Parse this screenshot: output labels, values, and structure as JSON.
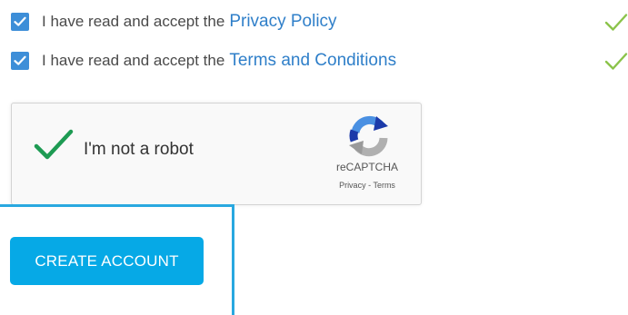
{
  "consents": [
    {
      "checked": true,
      "text": "I have read and accept the",
      "link": "Privacy Policy",
      "validated": true
    },
    {
      "checked": true,
      "text": "I have read and accept the",
      "link": "Terms and Conditions",
      "validated": true
    }
  ],
  "recaptcha": {
    "label": "I'm not a robot",
    "verified": true,
    "brand": "reCAPTCHA",
    "privacy_link": "Privacy",
    "separator": "-",
    "terms_link": "Terms"
  },
  "actions": {
    "create_account_label": "CREATE ACCOUNT"
  },
  "colors": {
    "checkbox": "#3d8ed8",
    "link": "#2f7fc9",
    "valid_check": "#8bc34a",
    "recaptcha_check": "#1e9b53",
    "button": "#06a9e6",
    "focus_frame": "#29a8e0"
  },
  "icons": {
    "checkbox_check": "check-icon",
    "validation": "check-mark-icon",
    "recaptcha_logo": "recaptcha-logo-icon"
  }
}
